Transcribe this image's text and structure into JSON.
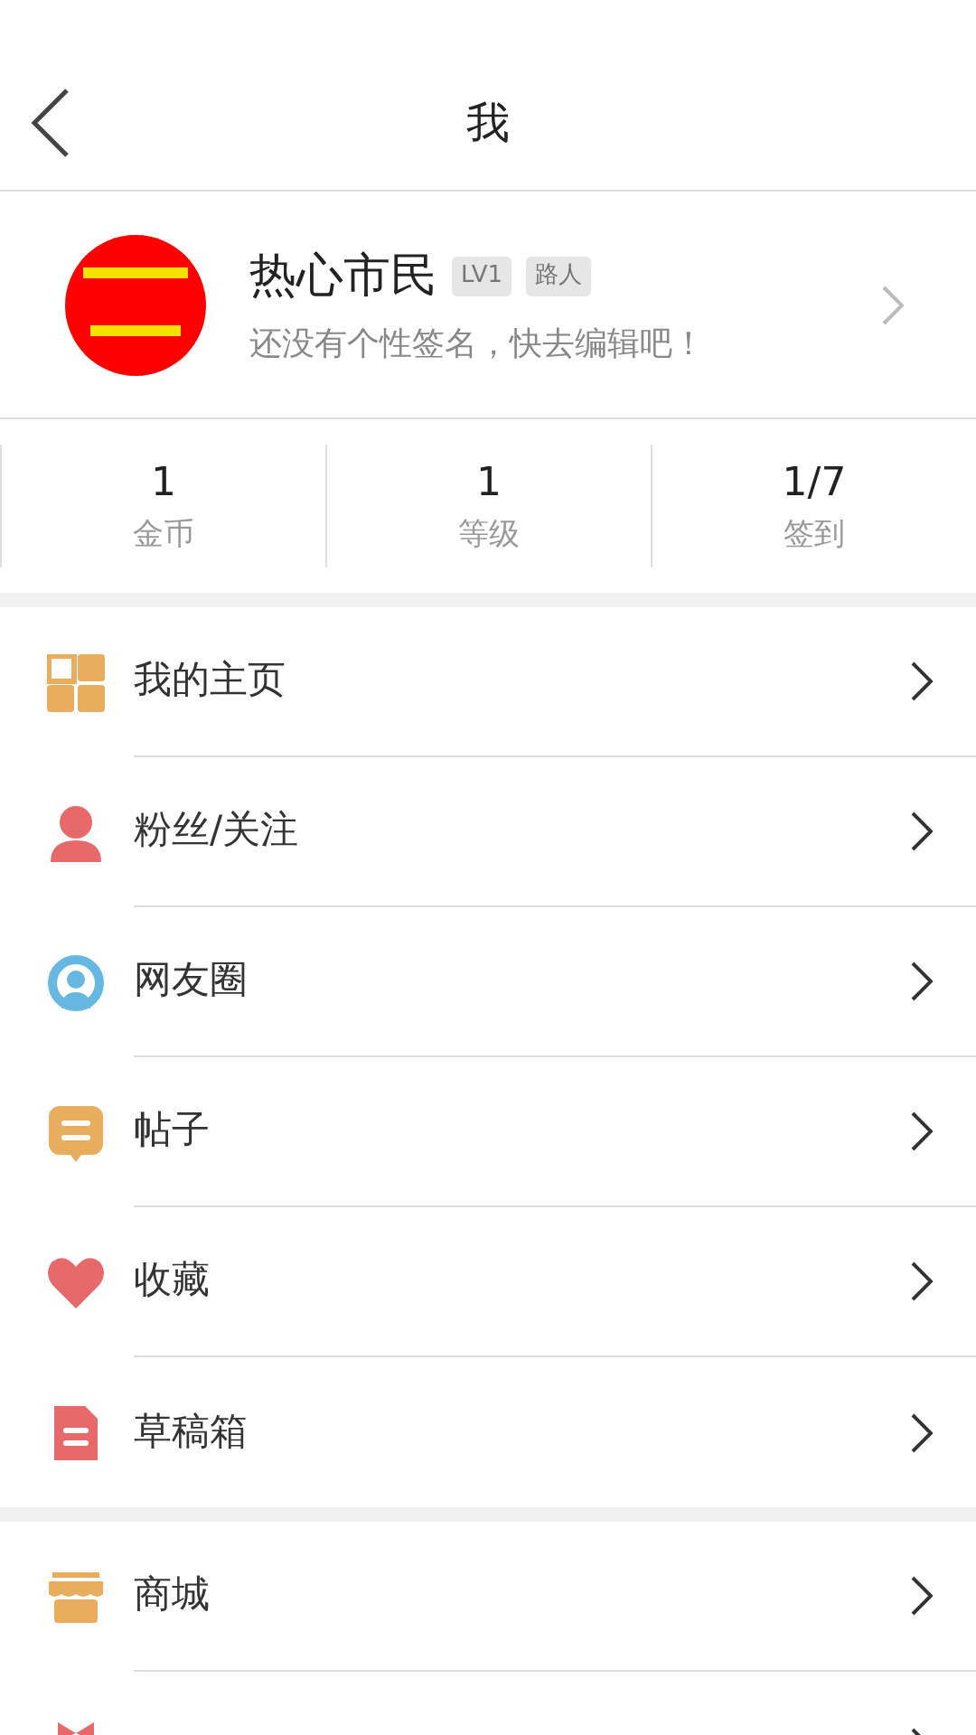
{
  "header": {
    "title": "我"
  },
  "profile": {
    "avatar": {
      "kind": "picture"
    },
    "name": "热心市民",
    "badges": [
      "LV1",
      "路人"
    ],
    "signature": "还没有个性签名，快去编辑吧！"
  },
  "stats": [
    {
      "value": "1",
      "label": "金币"
    },
    {
      "value": "1",
      "label": "等级"
    },
    {
      "value": "1/7",
      "label": "签到"
    }
  ],
  "menu_groups": [
    [
      {
        "kind": "grid",
        "label": "我的主页"
      },
      {
        "kind": "person",
        "label": "粉丝/关注"
      },
      {
        "kind": "circle",
        "label": "网友圈"
      },
      {
        "kind": "post",
        "label": "帖子"
      },
      {
        "kind": "heart",
        "label": "收藏"
      },
      {
        "kind": "draft",
        "label": "草稿箱"
      }
    ],
    [
      {
        "kind": "shop",
        "label": "商城"
      },
      {
        "kind": "gift"
      }
    ]
  ]
}
